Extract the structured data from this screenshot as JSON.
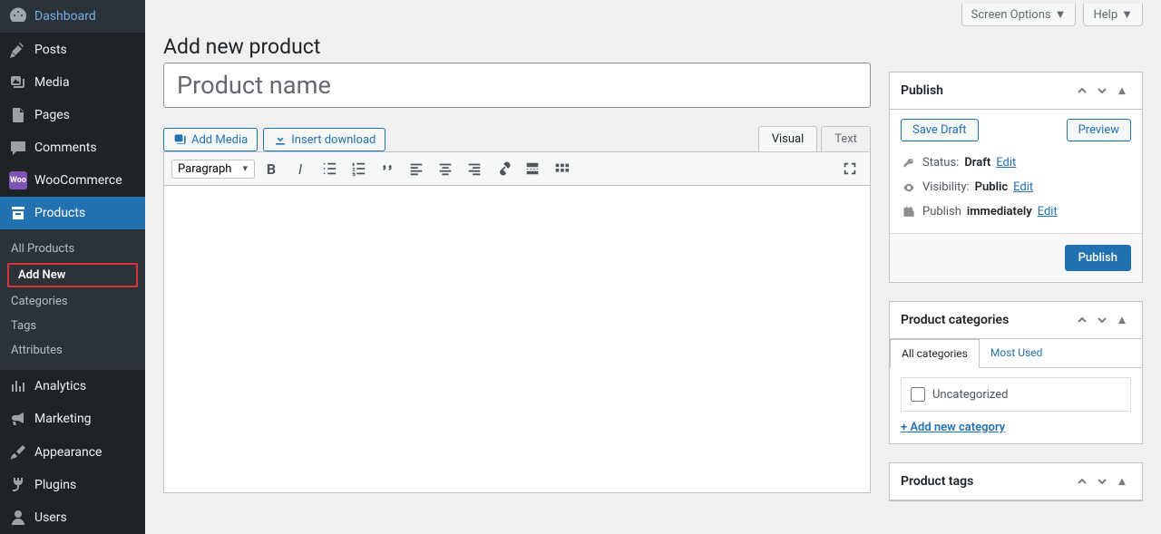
{
  "topbar": {
    "screen_options": "Screen Options",
    "help": "Help"
  },
  "sidebar": {
    "items": [
      {
        "label": "Dashboard"
      },
      {
        "label": "Posts"
      },
      {
        "label": "Media"
      },
      {
        "label": "Pages"
      },
      {
        "label": "Comments"
      },
      {
        "label": "WooCommerce"
      },
      {
        "label": "Products"
      },
      {
        "label": "Analytics"
      },
      {
        "label": "Marketing"
      },
      {
        "label": "Appearance"
      },
      {
        "label": "Plugins"
      },
      {
        "label": "Users"
      }
    ],
    "submenu": [
      {
        "label": "All Products"
      },
      {
        "label": "Add New"
      },
      {
        "label": "Categories"
      },
      {
        "label": "Tags"
      },
      {
        "label": "Attributes"
      }
    ]
  },
  "page": {
    "title": "Add new product",
    "title_placeholder": "Product name"
  },
  "editor": {
    "add_media": "Add Media",
    "insert_download": "Insert download",
    "tab_visual": "Visual",
    "tab_text": "Text",
    "paragraph": "Paragraph"
  },
  "publish": {
    "title": "Publish",
    "save_draft": "Save Draft",
    "preview": "Preview",
    "status_label": "Status:",
    "status_value": "Draft",
    "visibility_label": "Visibility:",
    "visibility_value": "Public",
    "schedule_label": "Publish",
    "schedule_value": "immediately",
    "edit": "Edit",
    "publish_btn": "Publish"
  },
  "categories": {
    "title": "Product categories",
    "tab_all": "All categories",
    "tab_most": "Most Used",
    "uncategorized": "Uncategorized",
    "add_new": "+ Add new category"
  },
  "tags": {
    "title": "Product tags"
  }
}
